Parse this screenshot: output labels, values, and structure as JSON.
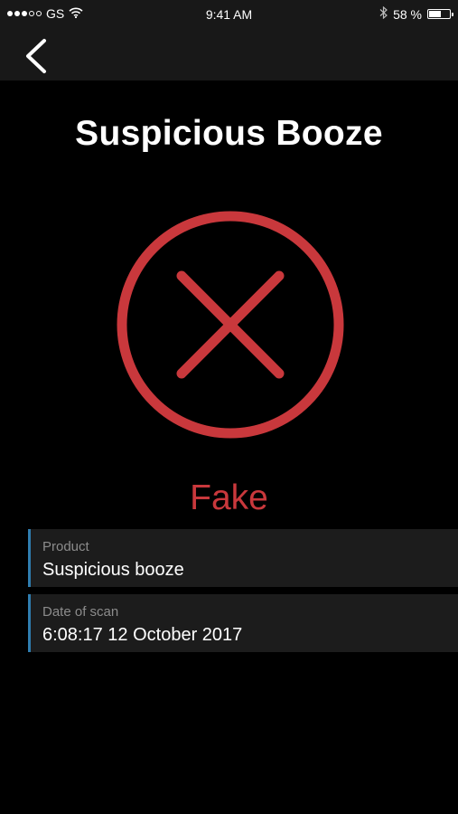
{
  "status_bar": {
    "carrier": "GS",
    "time": "9:41 AM",
    "battery_text": "58 %",
    "battery_level": 0.58,
    "signal_bars_filled": 3,
    "signal_bars_total": 5
  },
  "nav": {
    "back_icon": "chevron-left-icon"
  },
  "page": {
    "title": "Suspicious Booze"
  },
  "result": {
    "icon": "cross-circle-icon",
    "label": "Fake",
    "color": "#c9383c"
  },
  "details": {
    "product_label": "Product",
    "product_value": "Suspicious booze",
    "date_label": "Date of scan",
    "date_value": "6:08:17 12 October 2017",
    "accent_color": "#2f7db0"
  }
}
